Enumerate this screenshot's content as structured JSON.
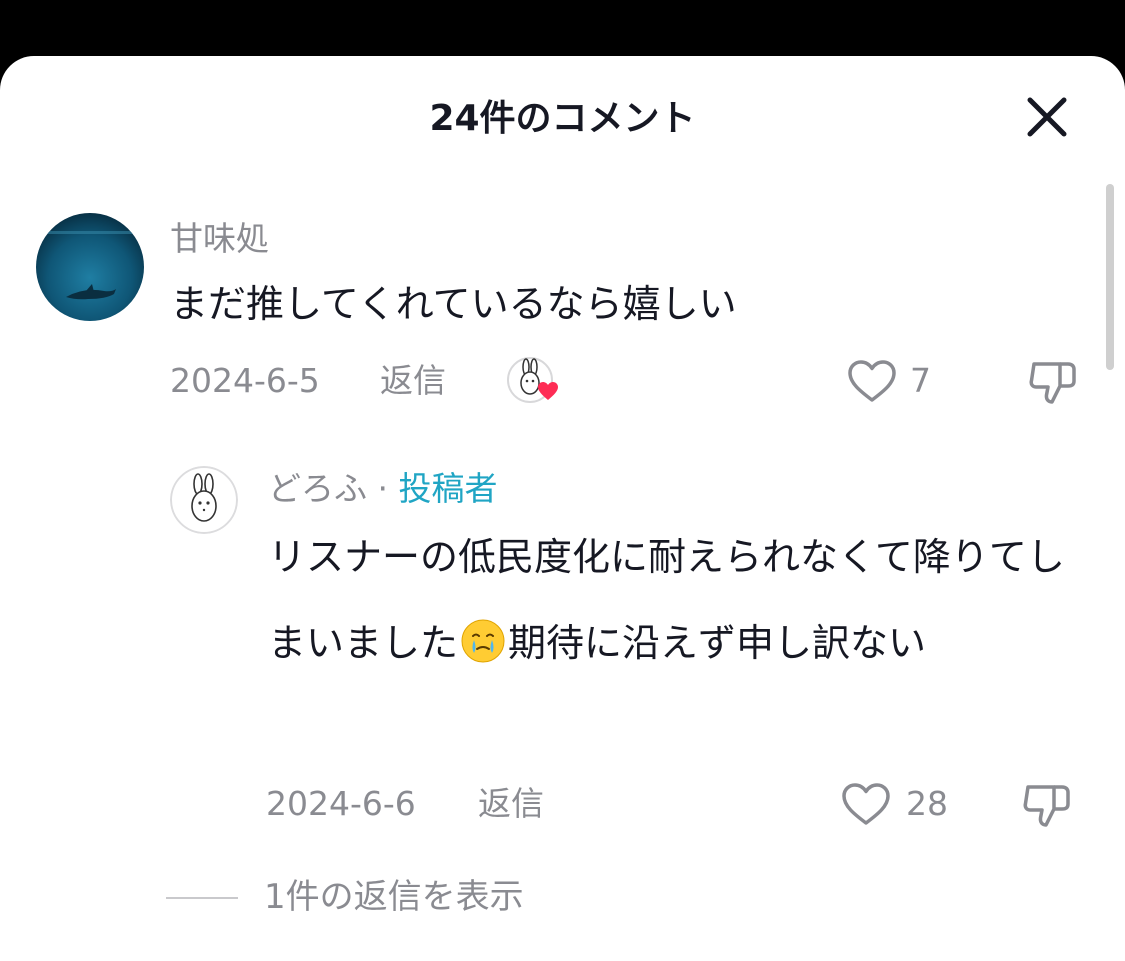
{
  "sheet": {
    "title": "24件のコメント"
  },
  "comments": [
    {
      "username": "甘味処",
      "text": "まだ推してくれているなら嬉しい",
      "date": "2024-6-5",
      "reply_label": "返信",
      "likes": "7",
      "liked_by_creator": true,
      "avatar_icon": "dolphin-photo"
    }
  ],
  "reply": {
    "username": "どろふ",
    "separator": "·",
    "badge": "投稿者",
    "text_part1": "リスナーの低民度化に耐えられなくて降りてしまいました",
    "emoji_icon": "face-holding-back-tears-icon",
    "text_part2": "期待に沿えず申し訳ない",
    "date": "2024-6-6",
    "reply_label": "返信",
    "likes": "28",
    "avatar_icon": "rabbit-drawing"
  },
  "view_replies": {
    "label": "1件の返信を表示"
  },
  "colors": {
    "accent_author": "#20a5c4",
    "heart_red": "#fe2c55",
    "text_primary": "#161823",
    "text_secondary": "#8a8b91"
  }
}
